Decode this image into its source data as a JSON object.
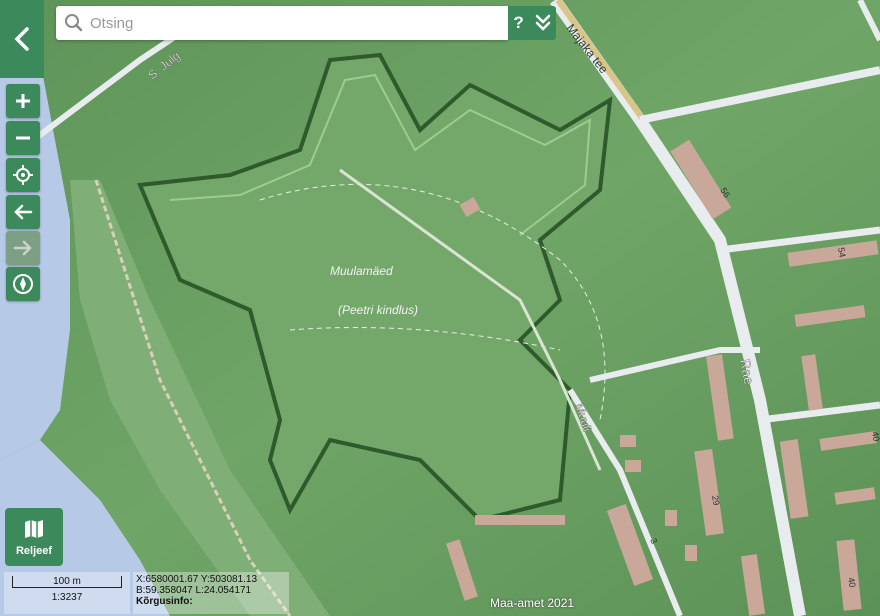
{
  "search": {
    "placeholder": "Otsing"
  },
  "toolbar": {
    "help_label": "?"
  },
  "layer": {
    "label": "Reljeef"
  },
  "scale": {
    "distance": "100 m",
    "ratio": "1:3237"
  },
  "coords": {
    "xy": "X:6580001.67 Y:503081.13",
    "bl": "B:59.358047 L:24.054171",
    "height_label": "Kõrgusinfo:"
  },
  "copyright": "Maa-amet 2021",
  "map_labels": {
    "park_name": "Muulamäed",
    "fort_name": "(Peetri kindlus)",
    "street_majaka": "Majaka tee",
    "street_rae": "Rae",
    "street_muuli": "Muuli",
    "street_sjulg": "S. Julg",
    "house_56": "56",
    "house_54": "54",
    "house_40a": "40",
    "house_40b": "40",
    "house_29": "29",
    "house_3": "3"
  },
  "colors": {
    "accent": "#3c8a5b",
    "terrain": "#6b9f63",
    "water": "#b6c9e6",
    "building": "#c9a89a"
  }
}
